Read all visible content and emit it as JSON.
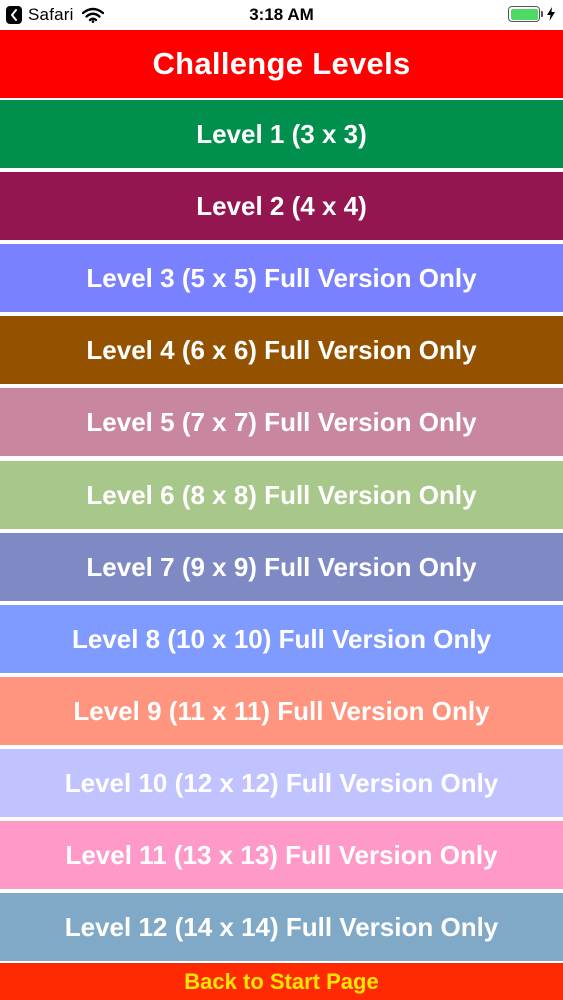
{
  "status_bar": {
    "back_app": "Safari",
    "time": "3:18 AM",
    "icons": [
      "back-arrow-icon",
      "wifi-icon",
      "battery-icon",
      "charging-bolt-icon"
    ],
    "battery_level": 1.0
  },
  "header": {
    "title": "Challenge Levels",
    "color": "#ff0000"
  },
  "levels": [
    {
      "label": "Level 1 (3 x 3)",
      "color": "#008f4c"
    },
    {
      "label": "Level 2 (4 x 4)",
      "color": "#941651"
    },
    {
      "label": "Level 3 (5 x 5) Full Version Only",
      "color": "#7a81ff"
    },
    {
      "label": "Level 4 (6 x 6) Full Version Only",
      "color": "#945200"
    },
    {
      "label": "Level 5 (7 x 7) Full Version Only",
      "color": "#c8869f"
    },
    {
      "label": "Level 6 (8 x 8) Full Version Only",
      "color": "#a8c78a"
    },
    {
      "label": "Level 7 (9 x 9) Full Version Only",
      "color": "#7f89c4"
    },
    {
      "label": "Level 8 (10 x 10) Full Version Only",
      "color": "#7f9bff"
    },
    {
      "label": "Level 9 (11 x 11) Full Version Only",
      "color": "#ff947f"
    },
    {
      "label": "Level 10 (12 x 12) Full Version Only",
      "color": "#c0c3ff"
    },
    {
      "label": "Level 11 (13 x 13) Full Version Only",
      "color": "#ff99c8"
    },
    {
      "label": "Level 12 (14 x 14) Full Version Only",
      "color": "#80a9c8"
    }
  ],
  "footer": {
    "back_label": "Back to Start Page",
    "background": "#ff2a00",
    "text_color": "#ffe600"
  }
}
